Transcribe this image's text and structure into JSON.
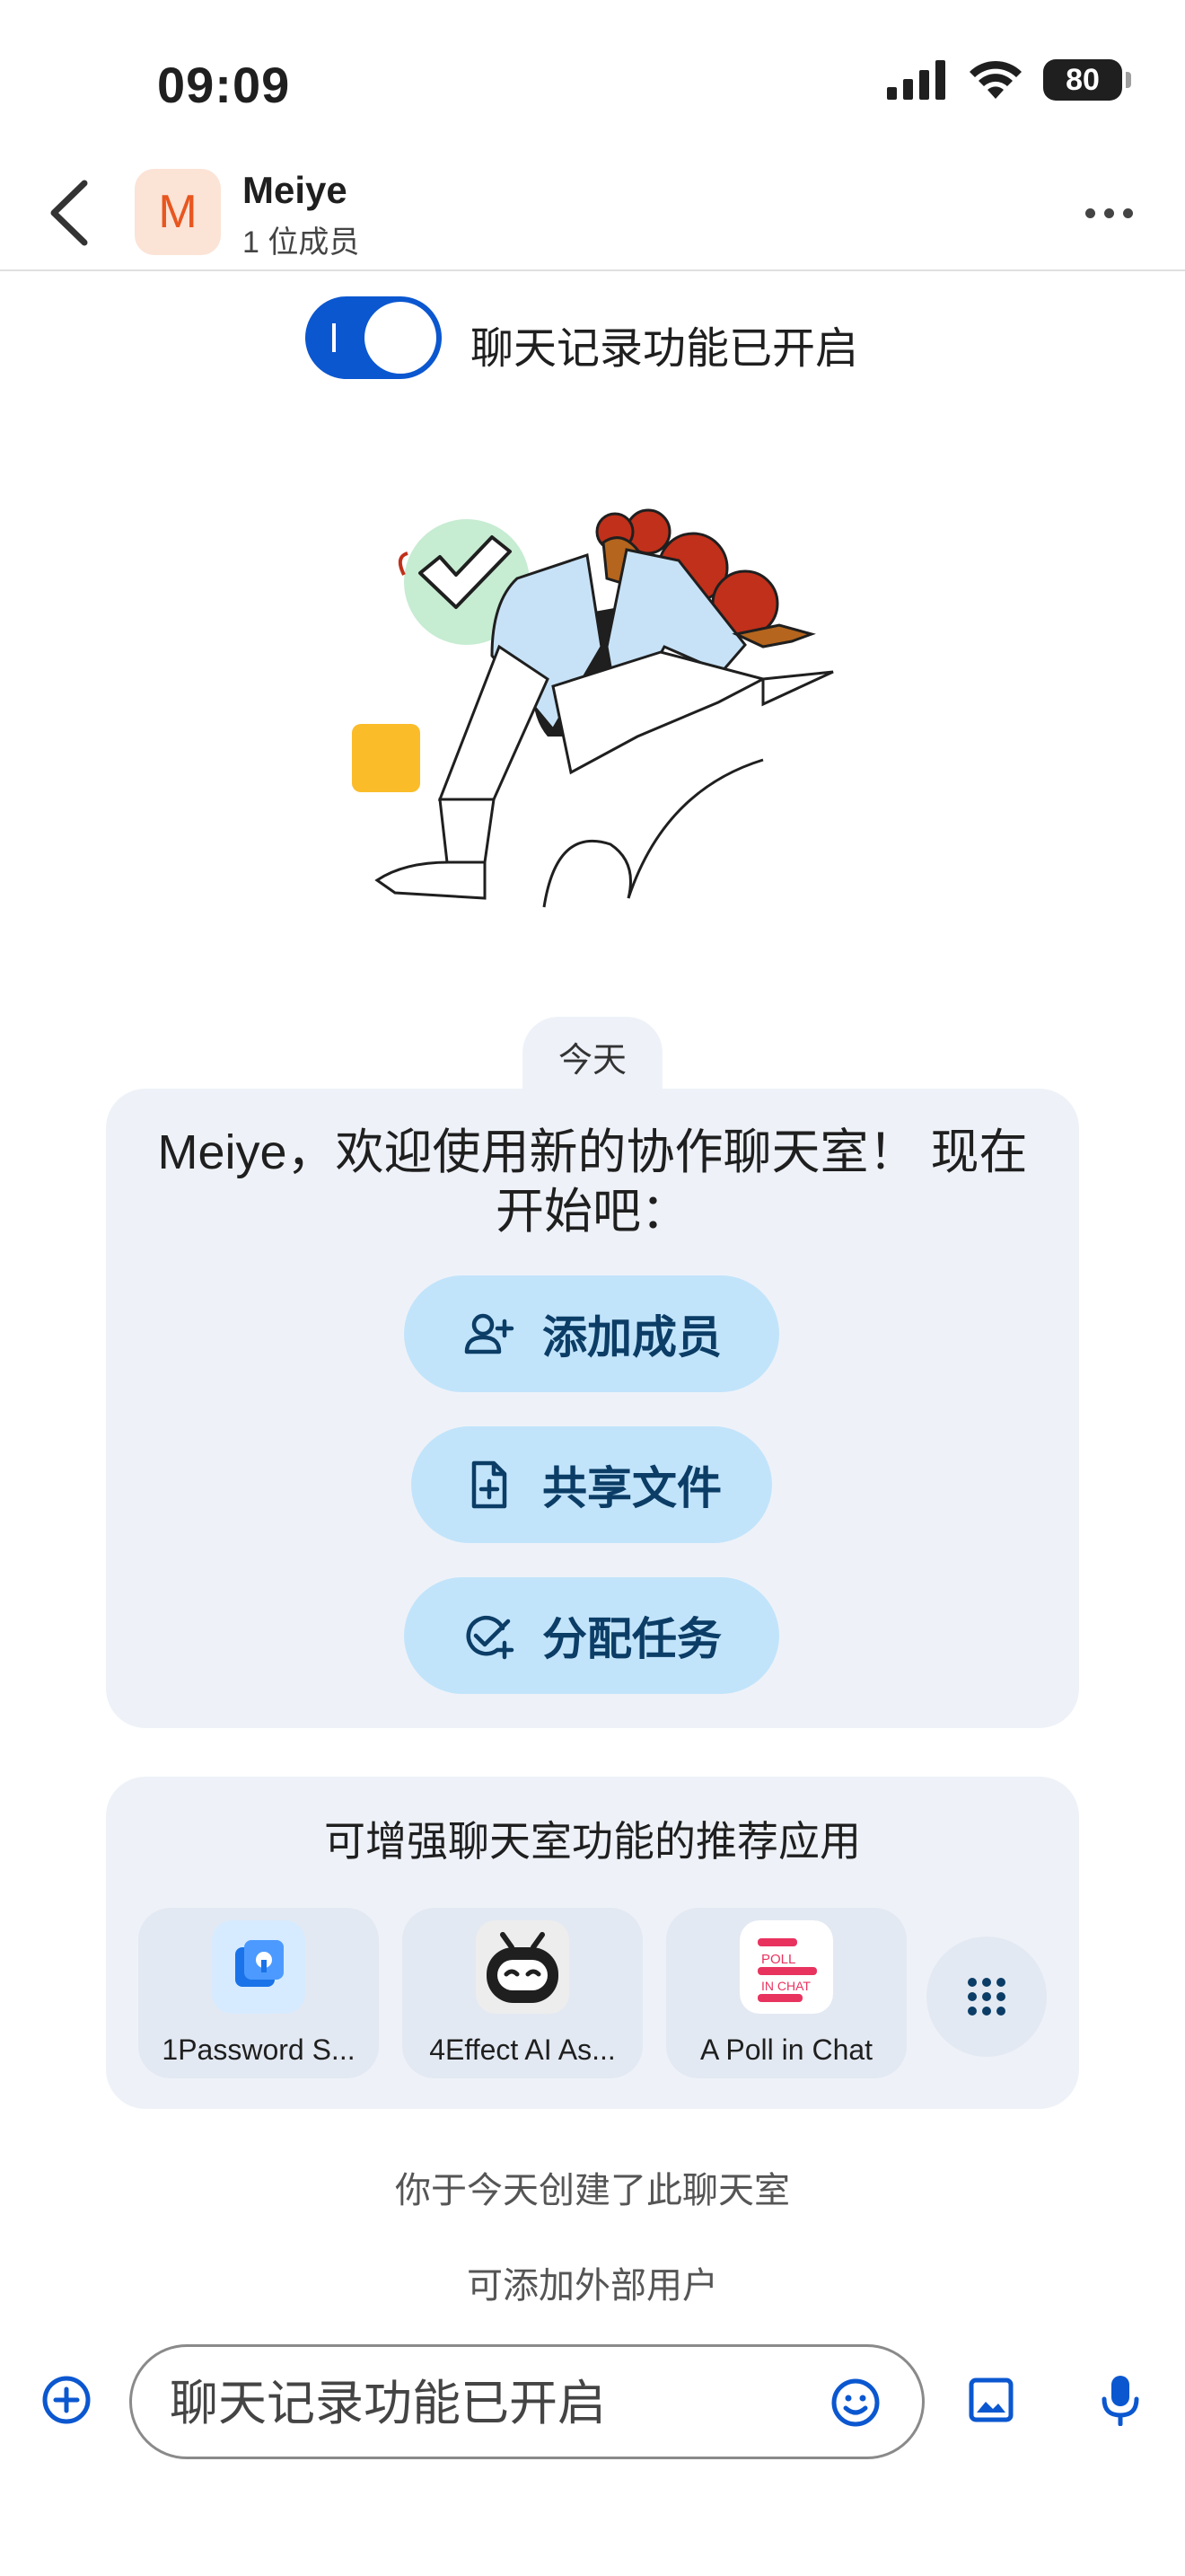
{
  "status_bar": {
    "time": "09:09",
    "battery": "80"
  },
  "header": {
    "avatar_letter": "M",
    "title": "Meiye",
    "subtitle": "1 位成员"
  },
  "history": {
    "toggle_on": true,
    "label": "聊天记录功能已开启"
  },
  "date_chip": "今天",
  "welcome": {
    "text": "Meiye，欢迎使用新的协作聊天室！ 现在开始吧：",
    "actions": [
      {
        "label": "添加成员",
        "icon": "add-person-icon"
      },
      {
        "label": "共享文件",
        "icon": "add-file-icon"
      },
      {
        "label": "分配任务",
        "icon": "add-task-icon"
      }
    ]
  },
  "apps": {
    "title": "可增强聊天室功能的推荐应用",
    "items": [
      {
        "name": "1Password S...",
        "icon": "1password-icon"
      },
      {
        "name": "4Effect AI As...",
        "icon": "robot-icon"
      },
      {
        "name": "A Poll in Chat",
        "icon": "poll-icon"
      }
    ],
    "more_icon": "apps-grid-icon"
  },
  "info": {
    "created": "你于今天创建了此聊天室",
    "external": "可添加外部用户"
  },
  "composer": {
    "placeholder": "聊天记录功能已开启"
  },
  "colors": {
    "accent": "#0b57d0",
    "pill_bg": "#c2e4fb",
    "card_bg": "#eef2f8",
    "avatar_bg": "#fbe3d6",
    "avatar_fg": "#e8561f"
  }
}
